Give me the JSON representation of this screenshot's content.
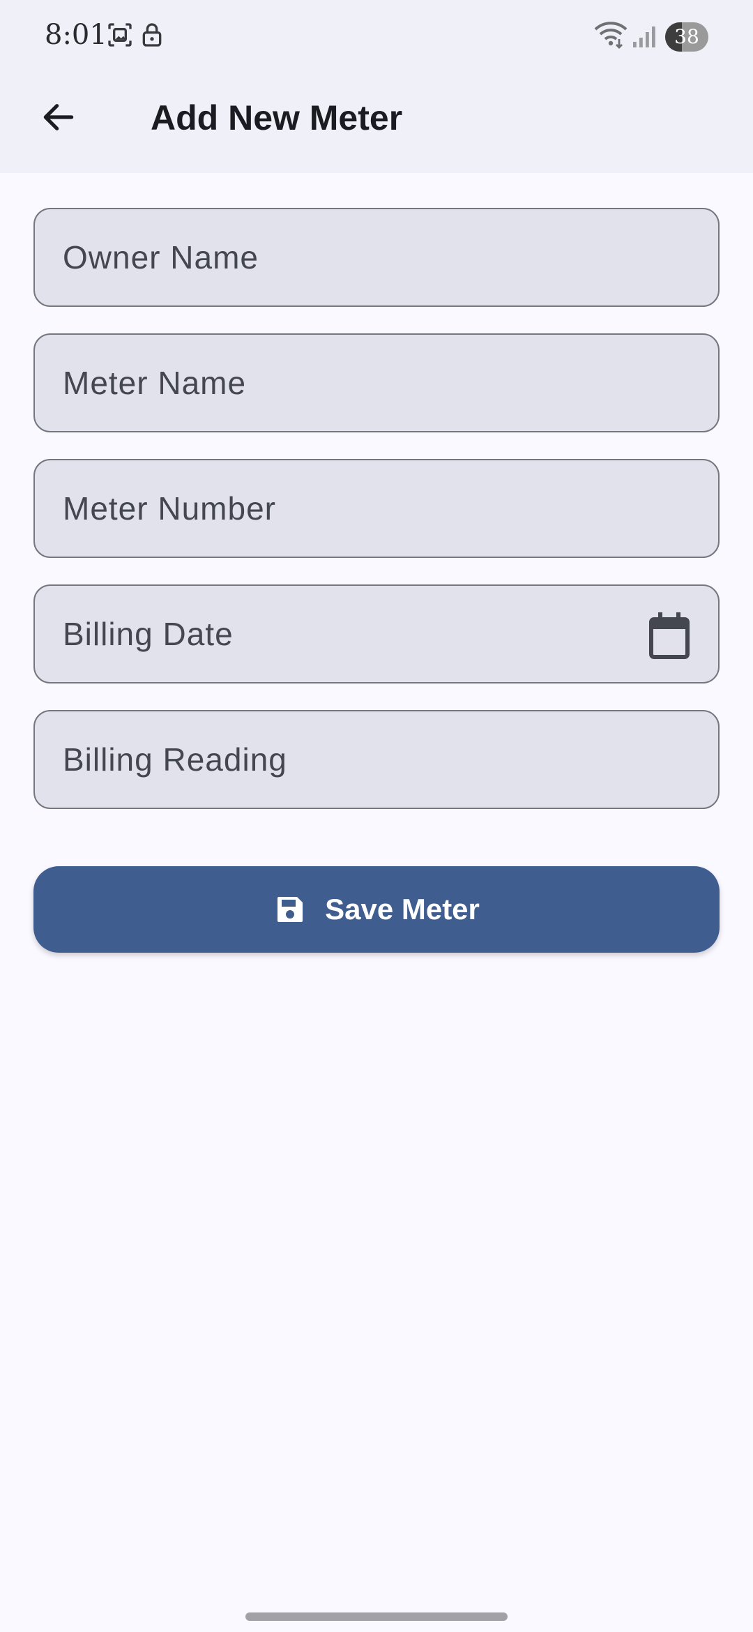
{
  "status_bar": {
    "time": "8:01",
    "battery_level": "38",
    "battery_fraction": 0.38,
    "icons": [
      "screenshot-icon",
      "lock-icon",
      "wifi-icon",
      "signal-icon"
    ]
  },
  "app_bar": {
    "title": "Add New Meter",
    "back_icon": "arrow-back-icon"
  },
  "form": {
    "fields": [
      {
        "placeholder": "Owner Name",
        "value": ""
      },
      {
        "placeholder": "Meter Name",
        "value": ""
      },
      {
        "placeholder": "Meter Number",
        "value": ""
      },
      {
        "placeholder": "Billing Date",
        "value": "",
        "trailing_icon": "calendar-icon"
      },
      {
        "placeholder": "Billing Reading",
        "value": ""
      }
    ],
    "save_button": {
      "label": "Save Meter",
      "icon": "save-icon"
    }
  },
  "colors": {
    "primary": "#405d8f",
    "field_fill": "#e1e2ec",
    "field_border": "#74777f",
    "background": "#f9f9ff",
    "app_bar": "#eff0f8"
  }
}
